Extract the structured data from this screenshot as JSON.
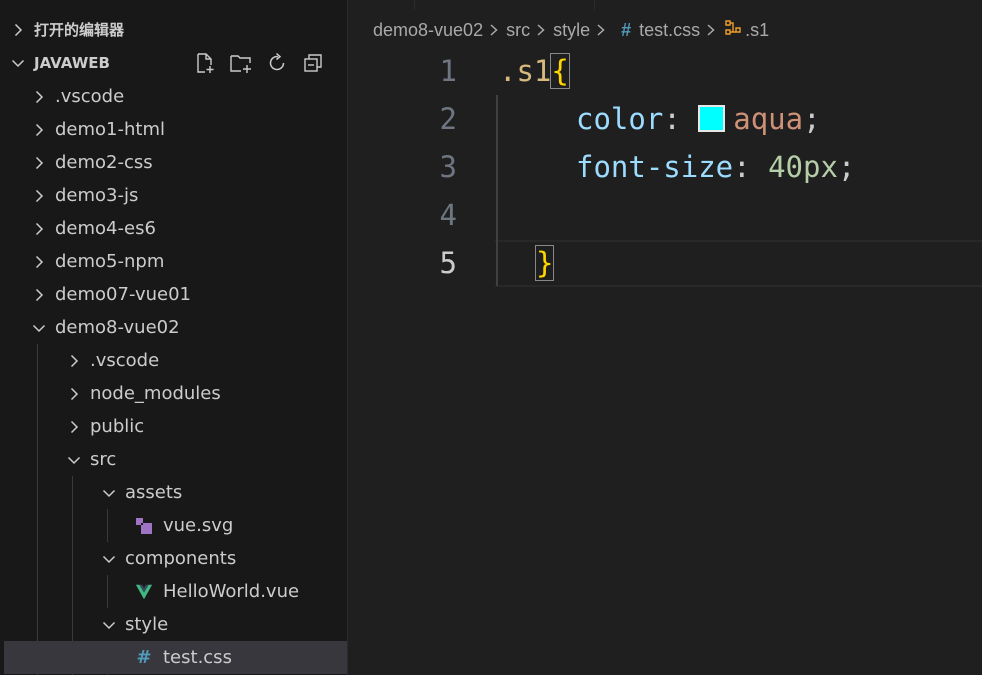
{
  "sidebar": {
    "open_editors_label": "打开的编辑器",
    "project_label": "JAVAWEB",
    "actions": [
      {
        "name": "new-file-icon"
      },
      {
        "name": "new-folder-icon"
      },
      {
        "name": "refresh-icon"
      },
      {
        "name": "collapse-all-icon"
      }
    ],
    "tree": [
      {
        "label": ".vscode",
        "expanded": false
      },
      {
        "label": "demo1-html",
        "expanded": false
      },
      {
        "label": "demo2-css",
        "expanded": false
      },
      {
        "label": "demo3-js",
        "expanded": false
      },
      {
        "label": "demo4-es6",
        "expanded": false
      },
      {
        "label": "demo5-npm",
        "expanded": false
      },
      {
        "label": "demo07-vue01",
        "expanded": false
      },
      {
        "label": "demo8-vue02",
        "expanded": true
      },
      {
        "label": ".vscode",
        "expanded": false
      },
      {
        "label": "node_modules",
        "expanded": false
      },
      {
        "label": "public",
        "expanded": false
      },
      {
        "label": "src",
        "expanded": true
      },
      {
        "label": "assets",
        "expanded": true
      },
      {
        "label": "vue.svg",
        "icon": "svg-file-icon"
      },
      {
        "label": "components",
        "expanded": true
      },
      {
        "label": "HelloWorld.vue",
        "icon": "vue-file-icon"
      },
      {
        "label": "style",
        "expanded": true
      },
      {
        "label": "test.css",
        "icon": "css-file-icon",
        "selected": true
      }
    ]
  },
  "breadcrumb": [
    "demo8-vue02",
    "src",
    "style",
    "test.css",
    ".s1"
  ],
  "editor": {
    "line_numbers": [
      "1",
      "2",
      "3",
      "4",
      "5"
    ],
    "active_line": "5",
    "selector": ".s1",
    "open_brace": "{",
    "close_brace": "}",
    "prop1": "color",
    "val1": "aqua",
    "prop2": "font-size",
    "val2": "40px",
    "colon": ":",
    "semicolon": ";",
    "swatch_color": "#00ffff"
  },
  "colors": {
    "selector": "#d7ba7d",
    "property": "#9cdcfe",
    "string_value": "#ce9178",
    "number_value": "#b5cea8",
    "brace": "#ffd700",
    "vue_green": "#41b883",
    "css_blue": "#519aba"
  }
}
